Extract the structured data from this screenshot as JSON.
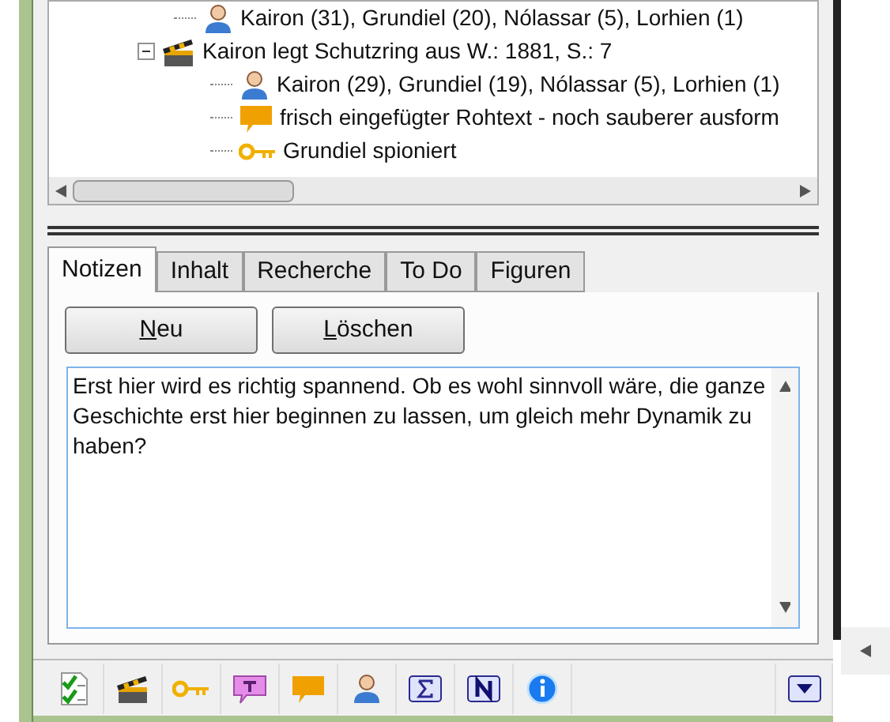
{
  "tree": {
    "items": [
      {
        "kind": "person",
        "label": "Kairon (31), Grundiel (20), Nólassar (5), Lorhien (1)"
      },
      {
        "kind": "scene",
        "label": "Kairon legt Schutzring aus  W.: 1881, S.: 7",
        "expanded": true,
        "children": [
          {
            "kind": "person",
            "label": "Kairon (29), Grundiel (19), Nólassar (5), Lorhien (1)"
          },
          {
            "kind": "text",
            "label": "frisch eingefügter Rohtext - noch sauberer ausform"
          },
          {
            "kind": "key",
            "label": "Grundiel spioniert"
          }
        ]
      }
    ]
  },
  "tabs": [
    {
      "label": "Notizen",
      "selected": true
    },
    {
      "label": "Inhalt",
      "selected": false
    },
    {
      "label": "Recherche",
      "selected": false
    },
    {
      "label": "To Do",
      "selected": false
    },
    {
      "label": "Figuren",
      "selected": false
    }
  ],
  "buttons": [
    {
      "mnemonic": "N",
      "rest": "eu"
    },
    {
      "mnemonic": "L",
      "rest": "öschen"
    }
  ],
  "note": {
    "value": "Erst hier wird es richtig spannend. Ob es wohl sinnvoll wäre, die ganze Geschichte erst hier beginnen zu lassen, um gleich mehr Dynamik zu haben?"
  },
  "toolbar": [
    {
      "kind": "checklist"
    },
    {
      "kind": "scene"
    },
    {
      "kind": "key"
    },
    {
      "kind": "T"
    },
    {
      "kind": "abc"
    },
    {
      "kind": "person"
    },
    {
      "kind": "sigma"
    },
    {
      "kind": "N"
    },
    {
      "kind": "info"
    }
  ]
}
